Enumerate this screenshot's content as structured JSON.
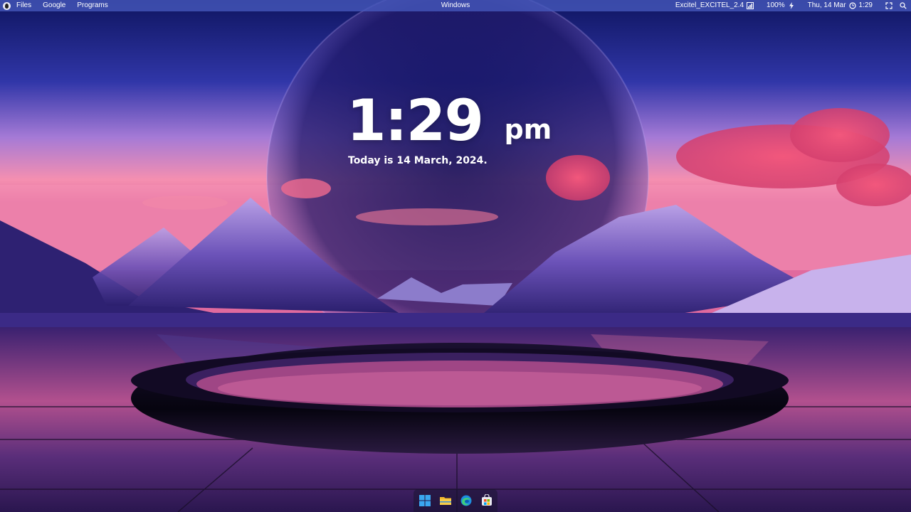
{
  "menubar": {
    "items": [
      "Files",
      "Google",
      "Programs"
    ],
    "window_title": "Windows",
    "network_name": "Excitel_EXCITEL_2.4",
    "battery": "100%",
    "datetime": "Thu, 14 Mar",
    "clock": "1:29"
  },
  "clock_widget": {
    "time": "1:29",
    "ampm": "pm",
    "date_text": "Today is 14 March, 2024."
  },
  "taskbar": {
    "icons": [
      "windows-start-icon",
      "file-explorer-icon",
      "edge-browser-icon",
      "microsoft-store-icon"
    ]
  },
  "colors": {
    "menubar_bg": "#4658be",
    "sky_top": "#111a6e",
    "clouds_pink": "#e0507a"
  }
}
